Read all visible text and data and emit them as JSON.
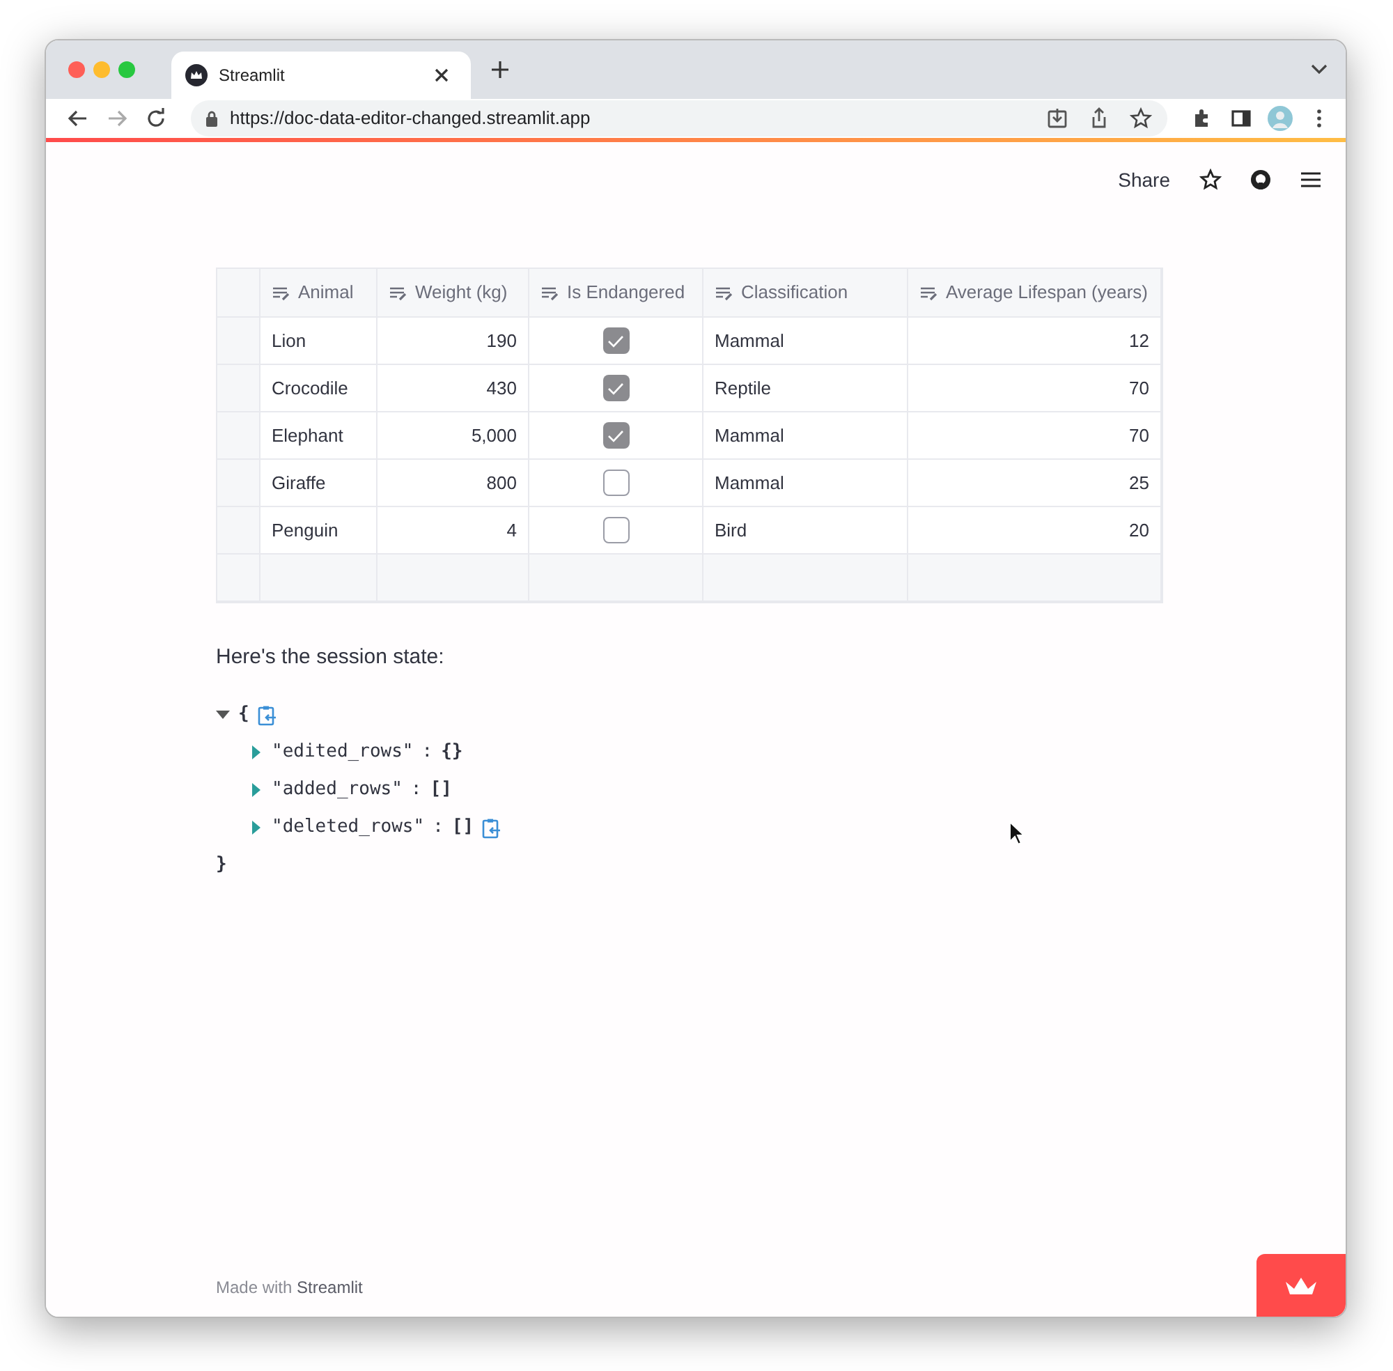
{
  "browser": {
    "tab_title": "Streamlit",
    "url": "https://doc-data-editor-changed.streamlit.app"
  },
  "header": {
    "share": "Share"
  },
  "table": {
    "columns": [
      {
        "label": "Animal",
        "kind": "text"
      },
      {
        "label": "Weight (kg)",
        "kind": "number"
      },
      {
        "label": "Is Endangered",
        "kind": "checkbox"
      },
      {
        "label": "Classification",
        "kind": "text"
      },
      {
        "label": "Average Lifespan (years)",
        "kind": "number"
      }
    ],
    "rows": [
      {
        "cells": [
          {
            "text": "Lion"
          },
          {
            "text": "190"
          },
          {
            "checked": true
          },
          {
            "text": "Mammal"
          },
          {
            "text": "12"
          }
        ]
      },
      {
        "cells": [
          {
            "text": "Crocodile"
          },
          {
            "text": "430"
          },
          {
            "checked": true
          },
          {
            "text": "Reptile"
          },
          {
            "text": "70"
          }
        ]
      },
      {
        "cells": [
          {
            "text": "Elephant"
          },
          {
            "text": "5,000"
          },
          {
            "checked": true
          },
          {
            "text": "Mammal"
          },
          {
            "text": "70"
          }
        ]
      },
      {
        "cells": [
          {
            "text": "Giraffe"
          },
          {
            "text": "800"
          },
          {
            "checked": false
          },
          {
            "text": "Mammal"
          },
          {
            "text": "25"
          }
        ]
      },
      {
        "cells": [
          {
            "text": "Penguin"
          },
          {
            "text": "4"
          },
          {
            "checked": false
          },
          {
            "text": "Bird"
          },
          {
            "text": "20"
          }
        ]
      }
    ]
  },
  "session_text": "Here's the session state:",
  "json_view": {
    "open": "{",
    "close": "}",
    "expanded": true,
    "copy_shown": true,
    "entries": [
      {
        "key": "\"edited_rows\"",
        "separator": ":",
        "value": "{}",
        "expanded": false,
        "copy_shown": false
      },
      {
        "key": "\"added_rows\"",
        "separator": ":",
        "value": "[]",
        "expanded": false,
        "copy_shown": false
      },
      {
        "key": "\"deleted_rows\"",
        "separator": ":",
        "value": "[]",
        "expanded": false,
        "copy_shown": true
      }
    ]
  },
  "footer": {
    "prefix": "Made with",
    "brand": "Streamlit"
  }
}
